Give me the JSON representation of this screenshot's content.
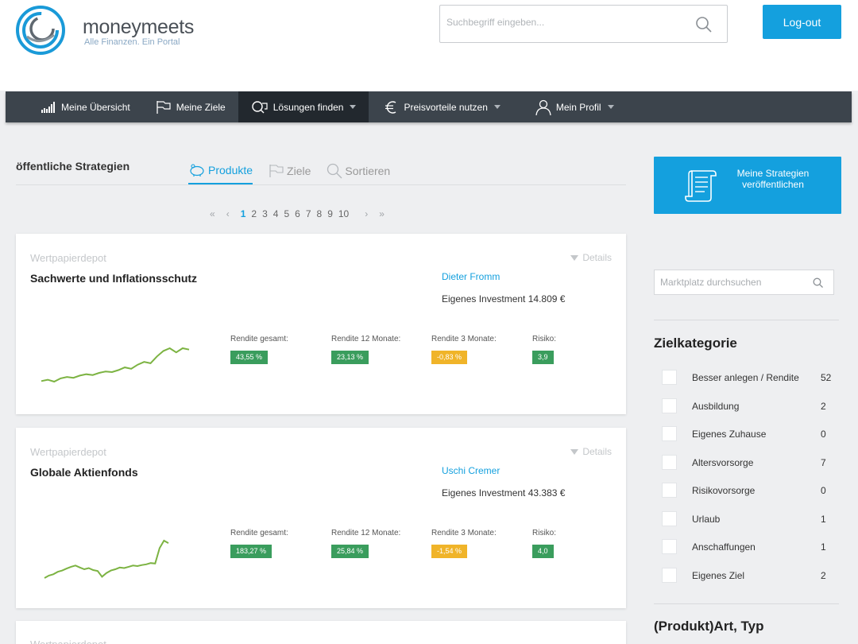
{
  "header": {
    "brand": "moneymeets",
    "tagline": "Alle Finanzen. Ein Portal",
    "search_placeholder": "Suchbegriff eingeben...",
    "logout_label": "Log-out"
  },
  "nav": {
    "items": [
      {
        "label": "Meine Übersicht",
        "icon": "bar-chart-icon"
      },
      {
        "label": "Meine Ziele",
        "icon": "flag-icon"
      },
      {
        "label": "Lösungen finden",
        "icon": "search-chat-icon",
        "active": true
      },
      {
        "label": "Preisvorteile nutzen",
        "icon": "euro-icon"
      },
      {
        "label": "Mein Profil",
        "icon": "user-icon"
      }
    ]
  },
  "main": {
    "section_title": "öffentliche Strategien",
    "tabs": [
      {
        "label": "Produkte",
        "active": true
      },
      {
        "label": "Ziele"
      },
      {
        "label": "Sortieren"
      }
    ],
    "pagination": {
      "first": "«",
      "prev": "‹",
      "pages": [
        "1",
        "2",
        "3",
        "4",
        "5",
        "6",
        "7",
        "8",
        "9",
        "10"
      ],
      "current": "1",
      "next": "›",
      "last": "»"
    },
    "cards": [
      {
        "product_type": "Wertpapierdepot",
        "details_label": "Details",
        "name": "Sachwerte und Inflationsschutz",
        "author": "Dieter Fromm",
        "investment": "Eigenes Investment 14.809 €",
        "metrics": [
          {
            "label": "Rendite gesamt:",
            "value": "43,55 %",
            "status": "positive"
          },
          {
            "label": "Rendite 12 Monate:",
            "value": "23,13 %",
            "status": "positive"
          },
          {
            "label": "Rendite 3 Monate:",
            "value": "-0,83 %",
            "status": "warning"
          },
          {
            "label": "Risiko:",
            "value": "3,9",
            "status": "positive"
          }
        ],
        "sparkline": [
          12,
          12.5,
          11.8,
          13,
          13.5,
          13.2,
          14,
          14.5,
          14.2,
          15,
          15.5,
          15.3,
          16,
          17,
          16.5,
          18,
          19,
          18.5,
          21,
          23,
          24,
          22.5,
          24,
          23.5
        ]
      },
      {
        "product_type": "Wertpapierdepot",
        "details_label": "Details",
        "name": "Globale Aktienfonds",
        "author": "Uschi Cremer",
        "investment": "Eigenes Investment 43.383 €",
        "metrics": [
          {
            "label": "Rendite gesamt:",
            "value": "183,27 %",
            "status": "positive"
          },
          {
            "label": "Rendite 12 Monate:",
            "value": "25,84 %",
            "status": "positive"
          },
          {
            "label": "Rendite 3 Monate:",
            "value": "-1,54 %",
            "status": "warning"
          },
          {
            "label": "Risiko:",
            "value": "4,0",
            "status": "positive"
          }
        ],
        "sparkline": [
          10,
          11,
          11.5,
          12.5,
          13,
          13.8,
          14.5,
          15,
          14.2,
          13.5,
          14,
          13.2,
          12.8,
          10.5,
          12,
          13,
          13.5,
          14.2,
          14,
          14.5,
          15,
          14.8,
          15.2,
          15.5,
          16,
          15.8,
          22,
          25,
          24
        ]
      }
    ],
    "third_card_type": "Wertpapierdepot"
  },
  "sidebar": {
    "publish_label": "Meine Strategien veröffentlichen",
    "market_search_placeholder": "Marktplatz durchsuchen",
    "zielkategorie_title": "Zielkategorie",
    "categories": [
      {
        "label": "Besser anlegen / Rendite",
        "count": "52"
      },
      {
        "label": "Ausbildung",
        "count": "2"
      },
      {
        "label": "Eigenes Zuhause",
        "count": "0"
      },
      {
        "label": "Altersvorsorge",
        "count": "7"
      },
      {
        "label": "Risikovorsorge",
        "count": "0"
      },
      {
        "label": "Urlaub",
        "count": "1"
      },
      {
        "label": "Anschaffungen",
        "count": "1"
      },
      {
        "label": "Eigenes Ziel",
        "count": "2"
      }
    ],
    "produkt_title": "(Produkt)Art, Typ"
  },
  "colors": {
    "accent": "#14a0de",
    "nav_bg": "#3c444c",
    "positive": "#3a9d5d",
    "warning": "#f0b429",
    "sparkline": "#7cb342"
  }
}
